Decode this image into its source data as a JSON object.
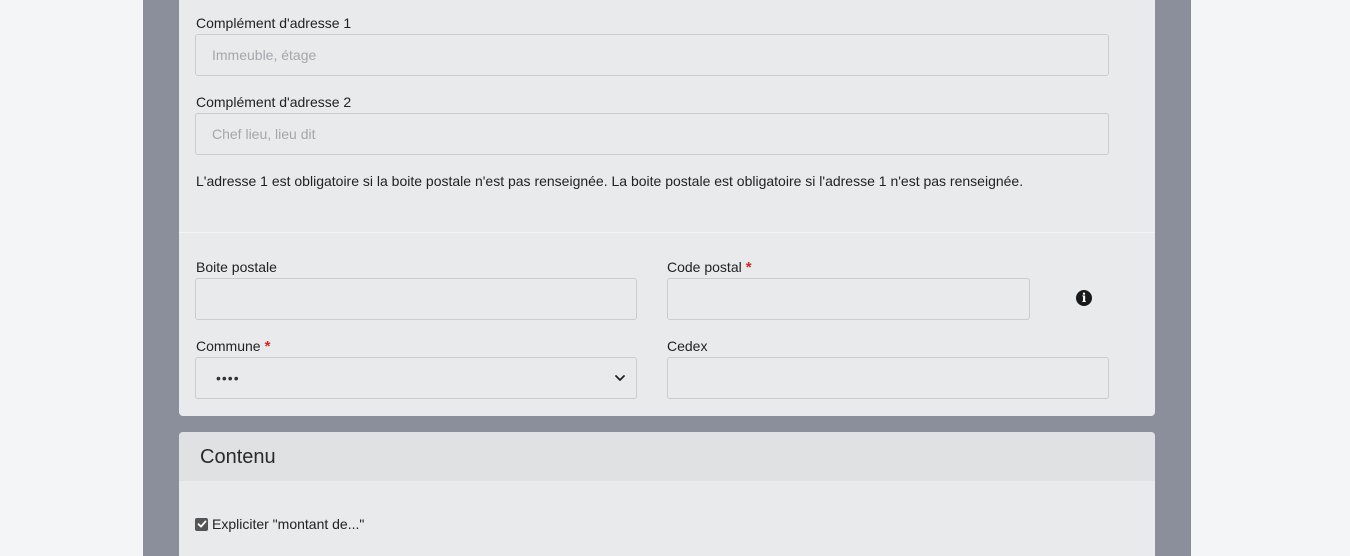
{
  "address": {
    "complement1": {
      "label": "Complément d'adresse 1",
      "placeholder": "Immeuble, étage",
      "value": ""
    },
    "complement2": {
      "label": "Complément d'adresse 2",
      "placeholder": "Chef lieu, lieu dit",
      "value": ""
    },
    "help_text": "L'adresse 1 est obligatoire si la boite postale n'est pas renseignée. La boite postale est obligatoire si l'adresse 1 n'est pas renseignée.",
    "postal_box": {
      "label": "Boite postale",
      "value": ""
    },
    "postal_code": {
      "label": "Code postal",
      "required_mark": "*",
      "value": ""
    },
    "commune": {
      "label": "Commune",
      "required_mark": "*",
      "selected": "••••"
    },
    "cedex": {
      "label": "Cedex",
      "value": ""
    },
    "info_icon": "info-circle-icon",
    "info_glyph": "i"
  },
  "content_section": {
    "title": "Contenu",
    "checkbox": {
      "label": "Expliciter \"montant de...\"",
      "checked": true
    }
  },
  "colors": {
    "backdrop": "#8b8f9b",
    "card": "#e8eaeb",
    "required": "#d9261c"
  }
}
